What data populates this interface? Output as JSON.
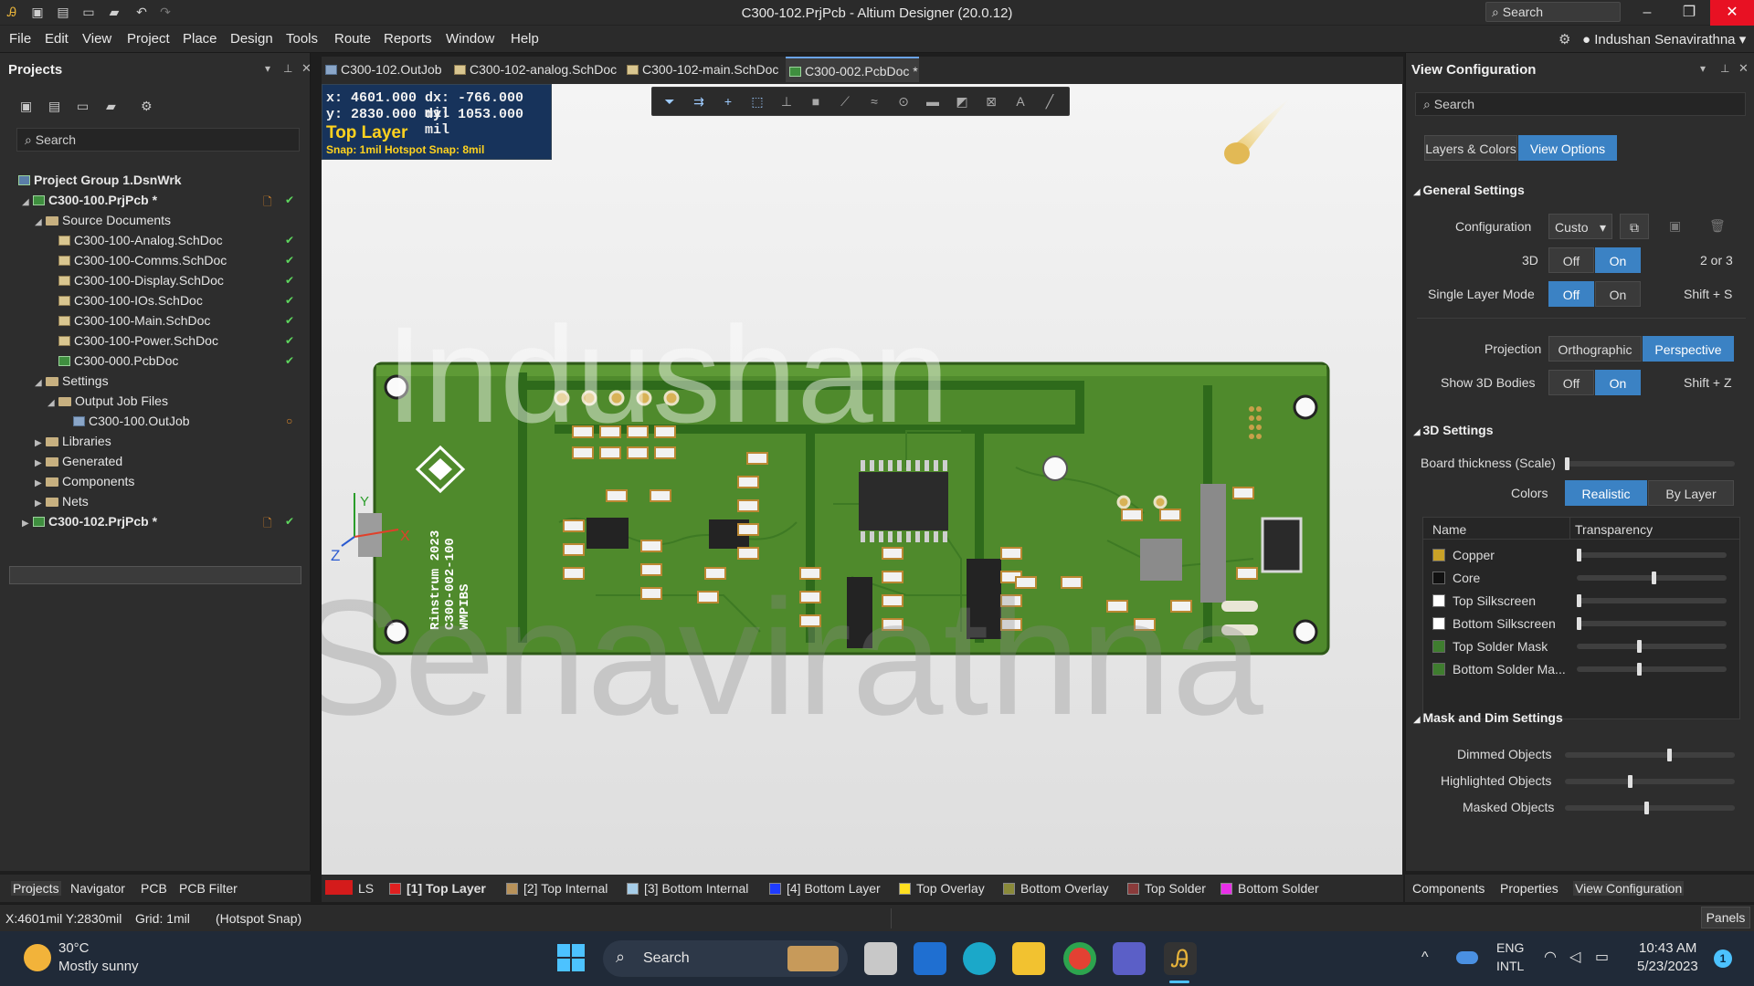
{
  "window": {
    "title": "C300-102.PrjPcb - Altium Designer (20.0.12)",
    "search_placeholder": "Search",
    "user": "Indushan Senavirathna"
  },
  "menu": [
    "File",
    "Edit",
    "View",
    "Project",
    "Place",
    "Design",
    "Tools",
    "Route",
    "Reports",
    "Window",
    "Help"
  ],
  "projects_panel": {
    "title": "Projects",
    "search_placeholder": "Search",
    "tree": {
      "group": "Project Group 1.DsnWrk",
      "p100": "C300-100.PrjPcb *",
      "source_docs": "Source Documents",
      "docs": [
        "C300-100-Analog.SchDoc",
        "C300-100-Comms.SchDoc",
        "C300-100-Display.SchDoc",
        "C300-100-IOs.SchDoc",
        "C300-100-Main.SchDoc",
        "C300-100-Power.SchDoc",
        "C300-000.PcbDoc"
      ],
      "settings": "Settings",
      "output_job_files": "Output Job Files",
      "outjob": "C300-100.OutJob",
      "libraries": "Libraries",
      "generated": "Generated",
      "components": "Components",
      "nets": "Nets",
      "p102": "C300-102.PrjPcb *"
    },
    "bottom_tabs": [
      "Projects",
      "Navigator",
      "PCB",
      "PCB Filter"
    ]
  },
  "doc_tabs": [
    "C300-102.OutJob",
    "C300-102-analog.SchDoc",
    "C300-102-main.SchDoc",
    "C300-002.PcbDoc *"
  ],
  "hud": {
    "x": "x:  4601.000",
    "dx": "dx:  -766.000 mil",
    "y": "y:  2830.000",
    "dy": "dy:  1053.000 mil",
    "layer": "Top Layer",
    "snap": "Snap: 1mil Hotspot Snap: 8mil"
  },
  "board": {
    "silk_brand": "Rinstrum 2023",
    "silk_part": "C300-002-100",
    "silk_code": "WMPIBS",
    "axis_x": "X",
    "axis_y": "Y",
    "axis_z": "Z",
    "watermark_1": "Indushan",
    "watermark_2": "Senavirathna"
  },
  "view_config": {
    "title": "View Configuration",
    "search_placeholder": "Search",
    "tabs": [
      "Layers & Colors",
      "View Options"
    ],
    "general_settings": "General Settings",
    "configuration_label": "Configuration",
    "configuration_value": "Custo",
    "threed_label": "3D",
    "off": "Off",
    "on": "On",
    "threed_hint": "2 or 3",
    "single_layer_label": "Single Layer Mode",
    "single_layer_hint": "Shift + S",
    "projection_label": "Projection",
    "orthographic": "Orthographic",
    "perspective": "Perspective",
    "show3d_label": "Show 3D Bodies",
    "show3d_hint": "Shift + Z",
    "threed_settings": "3D Settings",
    "board_thickness_label": "Board thickness (Scale)",
    "board_thickness_level": 0.0,
    "colors_label": "Colors",
    "realistic": "Realistic",
    "by_layer": "By Layer",
    "table_name": "Name",
    "table_transparency": "Transparency",
    "rows": [
      {
        "name": "Copper",
        "color": "#c9a227",
        "level": 0.0
      },
      {
        "name": "Core",
        "color": "#111111",
        "level": 0.5
      },
      {
        "name": "Top Silkscreen",
        "color": "#ffffff",
        "level": 0.0
      },
      {
        "name": "Bottom Silkscreen",
        "color": "#ffffff",
        "level": 0.0
      },
      {
        "name": "Top Solder Mask",
        "color": "#3f7d2f",
        "level": 0.4
      },
      {
        "name": "Bottom Solder Ma...",
        "color": "#3f7d2f",
        "level": 0.4
      }
    ],
    "mask_dim": "Mask and Dim Settings",
    "dimmed_label": "Dimmed Objects",
    "dimmed_level": 0.6,
    "highlighted_label": "Highlighted Objects",
    "highlighted_level": 0.37,
    "masked_label": "Masked Objects",
    "masked_level": 0.47,
    "bottom_tabs": [
      "Components",
      "Properties",
      "View Configuration"
    ]
  },
  "layers": [
    {
      "label": "LS",
      "color": "#d41b1b"
    },
    {
      "label": "[1] Top Layer",
      "color": "#e02020"
    },
    {
      "label": "[2] Top Internal",
      "color": "#b8925a"
    },
    {
      "label": "[3] Bottom Internal",
      "color": "#a6cde8"
    },
    {
      "label": "[4] Bottom Layer",
      "color": "#1f3cff"
    },
    {
      "label": "Top Overlay",
      "color": "#ffe020"
    },
    {
      "label": "Bottom Overlay",
      "color": "#8a8a3a"
    },
    {
      "label": "Top Solder",
      "color": "#8a3b3b"
    },
    {
      "label": "Bottom Solder",
      "color": "#e82fe8"
    }
  ],
  "status": {
    "coords": "X:4601mil Y:2830mil",
    "grid": "Grid: 1mil",
    "snap": "(Hotspot Snap)",
    "panels": "Panels"
  },
  "taskbar": {
    "temp": "30°C",
    "weather": "Mostly sunny",
    "search": "Search",
    "lang1": "ENG",
    "lang2": "INTL",
    "time": "10:43 AM",
    "date": "5/23/2023",
    "notif": "1"
  }
}
